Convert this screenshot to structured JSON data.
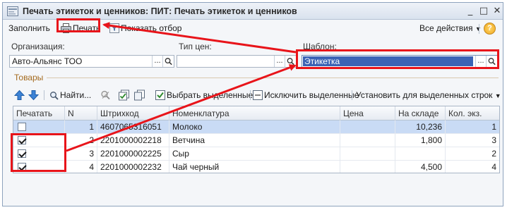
{
  "window": {
    "title": "Печать этикеток и ценников: ПИТ: Печать этикеток и ценников",
    "controls": {
      "minimize": "_",
      "maximize": "□",
      "close": "✕"
    }
  },
  "commands": {
    "fill": "Заполнить",
    "print": "Печать",
    "show_filter": "Показать отбор",
    "all_actions": "Все действия",
    "help": "?"
  },
  "fields": {
    "organization": {
      "label": "Организация:",
      "value": "Авто-Альянс ТОО"
    },
    "price_type": {
      "label": "Тип цен:",
      "value": ""
    },
    "template": {
      "label": "Шаблон:",
      "value": "Этикетка"
    },
    "picker_dots": "..."
  },
  "goods": {
    "group_title": "Товары",
    "toolbar": {
      "find": "Найти...",
      "select_selected": "Выбрать выделенные",
      "exclude_selected": "Исключить выделенные",
      "set_for_rows": "Установить для выделенных строк"
    },
    "columns": [
      "Печатать",
      "N",
      "Штрихкод",
      "Номенклатура",
      "Цена",
      "На складе",
      "Кол. экз."
    ],
    "rows": [
      {
        "print": false,
        "n": "1",
        "barcode": "4607065316051",
        "item": "Молоко",
        "price": "",
        "stock": "10,236",
        "qty": "1"
      },
      {
        "print": true,
        "n": "2",
        "barcode": "2201000002218",
        "item": "Ветчина",
        "price": "",
        "stock": "1,800",
        "qty": "3"
      },
      {
        "print": true,
        "n": "3",
        "barcode": "2201000002225",
        "item": "Сыр",
        "price": "",
        "stock": "",
        "qty": "2"
      },
      {
        "print": true,
        "n": "4",
        "barcode": "2201000002232",
        "item": "Чай черный",
        "price": "",
        "stock": "4,500",
        "qty": "4"
      }
    ]
  },
  "colors": {
    "annotation": "#e8141a",
    "selection": "#3b63b5",
    "group_title": "#a46a1e"
  },
  "icons": [
    "app-icon",
    "printer-icon",
    "filter-icon",
    "dropdown-arrow-icon",
    "help-icon",
    "arrow-up-icon",
    "arrow-down-icon",
    "search-icon",
    "clear-search-icon",
    "check-all-icon",
    "copy-icon",
    "select-selected-icon",
    "exclude-selected-icon"
  ]
}
